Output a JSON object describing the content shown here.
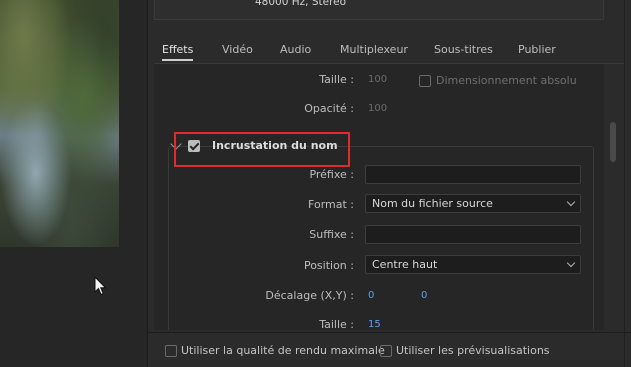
{
  "audio": {
    "info": "48000 Hz, Stéréo"
  },
  "tabs": [
    {
      "label": "Effets",
      "active": true
    },
    {
      "label": "Vidéo",
      "active": false
    },
    {
      "label": "Audio",
      "active": false
    },
    {
      "label": "Multiplexeur",
      "active": false
    },
    {
      "label": "Sous-titres",
      "active": false
    },
    {
      "label": "Publier",
      "active": false
    }
  ],
  "effects": {
    "taille_label": "Taille :",
    "taille_value": "100",
    "dim_absolu_label": "Dimensionnement absolu",
    "opacite_label": "Opacité :",
    "opacite_value": "100",
    "section_title": "Incrustation du nom",
    "section_checked": true,
    "prefixe_label": "Préfixe :",
    "prefixe_value": "",
    "format_label": "Format :",
    "format_value": "Nom du fichier source",
    "suffixe_label": "Suffixe :",
    "suffixe_value": "",
    "position_label": "Position :",
    "position_value": "Centre haut",
    "decalage_label": "Décalage (X,Y) :",
    "decalage_x": "0",
    "decalage_y": "0",
    "taille2_label": "Taille :",
    "taille2_value": "15"
  },
  "bottom": {
    "max_quality_label": "Utiliser la qualité de rendu maximale",
    "previews_label": "Utiliser les prévisualisations"
  },
  "colors": {
    "highlight": "#e02b2b",
    "link_value": "#5aa0e6"
  }
}
